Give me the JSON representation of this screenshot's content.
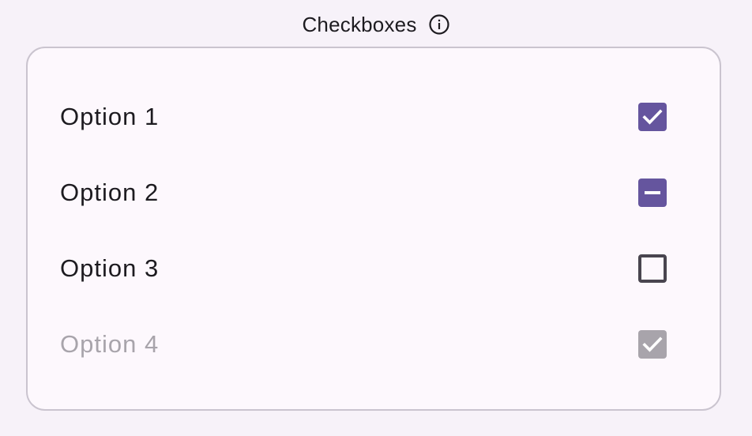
{
  "colors": {
    "accent": "#65559e",
    "disabled": "#a8a4ab",
    "border": "#cac4cf",
    "unchecked_border": "#49454f"
  },
  "header": {
    "title": "Checkboxes",
    "icon": "info-icon"
  },
  "options": [
    {
      "label": "Option 1",
      "state": "checked",
      "enabled": true
    },
    {
      "label": "Option 2",
      "state": "indeterminate",
      "enabled": true
    },
    {
      "label": "Option 3",
      "state": "unchecked",
      "enabled": true
    },
    {
      "label": "Option 4",
      "state": "checked",
      "enabled": false
    }
  ]
}
